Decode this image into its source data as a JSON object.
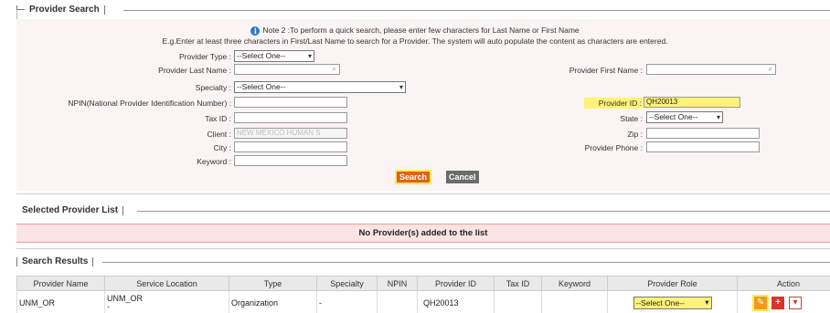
{
  "provider_search": {
    "legend": "Provider Search",
    "note_line1": "Note 2 :To perform a quick search, please enter few characters for Last Name or First Name",
    "note_line2": "E.g.Enter at least three characters in First/Last Name to search for a Provider. The system will auto populate the content as characters are entered.",
    "fields": {
      "provider_type_label": "Provider Type :",
      "provider_type_value": "--Select One--",
      "last_name_label": "Provider Last Name :",
      "last_name_value": "",
      "first_name_label": "Provider First Name :",
      "first_name_value": "",
      "specialty_label": "Specialty :",
      "specialty_value": "--Select One--",
      "npin_label": "NPIN(National Provider Identification Number) :",
      "npin_value": "",
      "provider_id_label": "Provider ID :",
      "provider_id_value": "QH20013",
      "tax_id_label": "Tax ID :",
      "tax_id_value": "",
      "state_label": "State :",
      "state_value": "--Select One--",
      "client_label": "Client :",
      "client_value": "NEW MEXICO HUMAN S",
      "zip_label": "Zip :",
      "zip_value": "",
      "city_label": "City :",
      "city_value": "",
      "provider_phone_label": "Provider Phone :",
      "provider_phone_value": "",
      "keyword_label": "Keyword :",
      "keyword_value": ""
    },
    "search_button": "Search",
    "cancel_button": "Cancel"
  },
  "selected_list": {
    "legend": "Selected Provider List",
    "empty_message": "No Provider(s) added to the list"
  },
  "results": {
    "legend": "Search Results",
    "columns": [
      "Provider Name",
      "Service Location",
      "Type",
      "Specialty",
      "NPIN",
      "Provider ID",
      "Tax ID",
      "Keyword",
      "Provider Role",
      "Action"
    ],
    "rows": [
      {
        "provider_name": "UNM_OR",
        "service_location": "UNM_OR",
        "service_location_sub": "-",
        "type": "Organization",
        "specialty": "-",
        "npin": "",
        "provider_id": "QH20013",
        "tax_id": "",
        "keyword": "",
        "provider_role": "--Select One--"
      }
    ]
  },
  "icons": {
    "info": "info-icon",
    "search": "magnifier-icon",
    "edit": "edit-icon",
    "add": "add-icon",
    "delete": "delete-icon"
  },
  "colors": {
    "highlight": "#fff27a",
    "search_button": "#e0621b",
    "cancel_button": "#6b6b6b",
    "panel_bg": "#fbf4f4",
    "banner_bg": "#fbe4e4"
  }
}
